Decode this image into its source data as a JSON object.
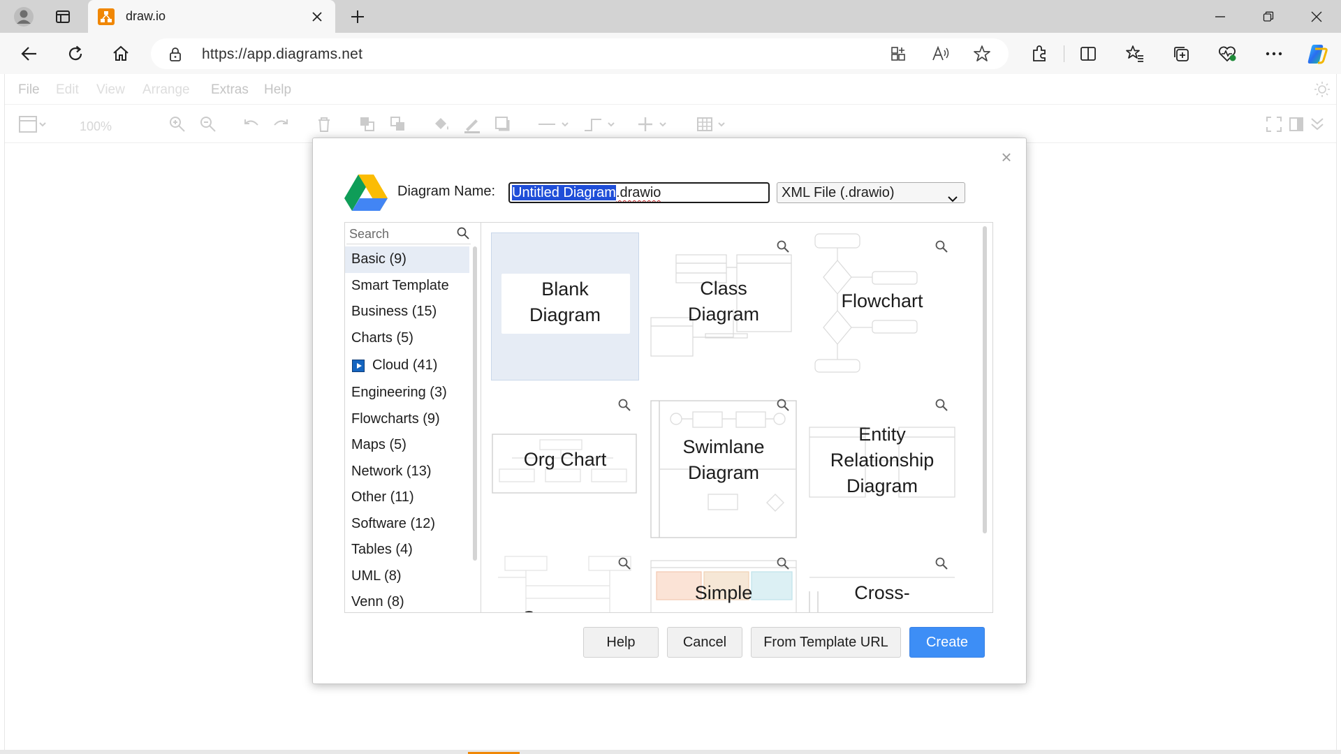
{
  "browser": {
    "tab_title": "draw.io",
    "url": "https://app.diagrams.net",
    "new_tab_label": "+"
  },
  "app": {
    "menu": [
      "File",
      "Edit",
      "View",
      "Arrange",
      "Extras",
      "Help"
    ],
    "zoom": "100%"
  },
  "dialog": {
    "name_label": "Diagram Name:",
    "name_selected": "Untitled Diagram",
    "name_extension": ".drawio",
    "format": "XML File (.drawio)",
    "close_label": "×",
    "search_placeholder": "Search",
    "categories": [
      "Basic (9)",
      "Smart Template",
      "Business (15)",
      "Charts (5)",
      "Cloud (41)",
      "Engineering (3)",
      "Flowcharts (9)",
      "Maps (5)",
      "Network (13)",
      "Other (11)",
      "Software (12)",
      "Tables (4)",
      "UML (8)",
      "Venn (8)"
    ],
    "templates": [
      [
        "Blank",
        "Diagram"
      ],
      [
        "Class",
        "Diagram"
      ],
      [
        "Flowchart"
      ],
      [
        "Org Chart"
      ],
      [
        "Swimlane",
        "Diagram"
      ],
      [
        "Entity",
        "Relationship",
        "Diagram"
      ],
      [
        "Sequence"
      ],
      [
        "Simple"
      ],
      [
        "Cross-"
      ]
    ],
    "buttons": {
      "help": "Help",
      "cancel": "Cancel",
      "template_url": "From Template URL",
      "create": "Create"
    }
  },
  "colors": {
    "accent": "#3d8ef6",
    "selection": "#1f4ed8",
    "drawio_orange": "#f08705",
    "selected_tile": "#e6ecf5"
  }
}
